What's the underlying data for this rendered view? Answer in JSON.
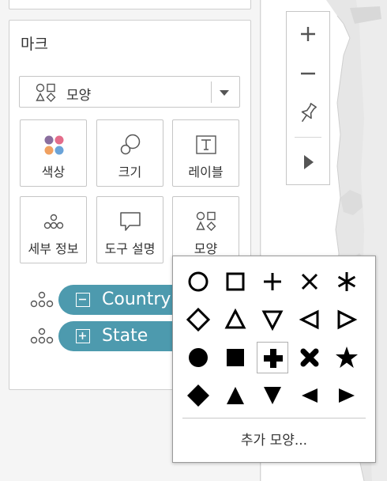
{
  "marks_card": {
    "title": "마크",
    "mark_type": {
      "icon": "shapes-icon",
      "selected": "모양"
    },
    "encodings": [
      {
        "name": "encoding-color",
        "icon": "color-dots-icon",
        "label": "색상"
      },
      {
        "name": "encoding-size",
        "icon": "size-icon",
        "label": "크기"
      },
      {
        "name": "encoding-label",
        "icon": "text-label-icon",
        "label": "레이블"
      },
      {
        "name": "encoding-detail",
        "icon": "detail-dots-icon",
        "label": "세부 정보"
      },
      {
        "name": "encoding-tooltip",
        "icon": "tooltip-icon",
        "label": "도구 설명"
      },
      {
        "name": "encoding-shape",
        "icon": "shapes-icon",
        "label": "모양"
      }
    ],
    "pills": [
      {
        "label": "Country",
        "state": "collapse",
        "icon": "minus-box-icon"
      },
      {
        "label": "State",
        "state": "expand",
        "icon": "plus-box-icon"
      }
    ],
    "colors": {
      "pill": "#4d9aae",
      "color_dots": [
        "#8a6e9e",
        "#e46c8a",
        "#f0a060",
        "#6aa3d8"
      ]
    }
  },
  "map_toolbar": {
    "buttons": [
      "zoom-in-icon",
      "zoom-out-icon",
      "pin-icon",
      "play-icon"
    ]
  },
  "shape_palette": {
    "rows": [
      [
        "circle-open",
        "square-open",
        "plus-thin",
        "cross-thin",
        "asterisk"
      ],
      [
        "diamond-open",
        "triangle-up-open",
        "triangle-down-open",
        "triangle-left-open",
        "triangle-right-open"
      ],
      [
        "circle-filled",
        "square-filled",
        "plus-filled",
        "cross-filled",
        "star-filled"
      ],
      [
        "diamond-filled",
        "triangle-up-filled",
        "triangle-down-filled",
        "triangle-left-filled",
        "triangle-right-filled"
      ]
    ],
    "selected": "plus-filled",
    "more_label": "추가 모양..."
  }
}
